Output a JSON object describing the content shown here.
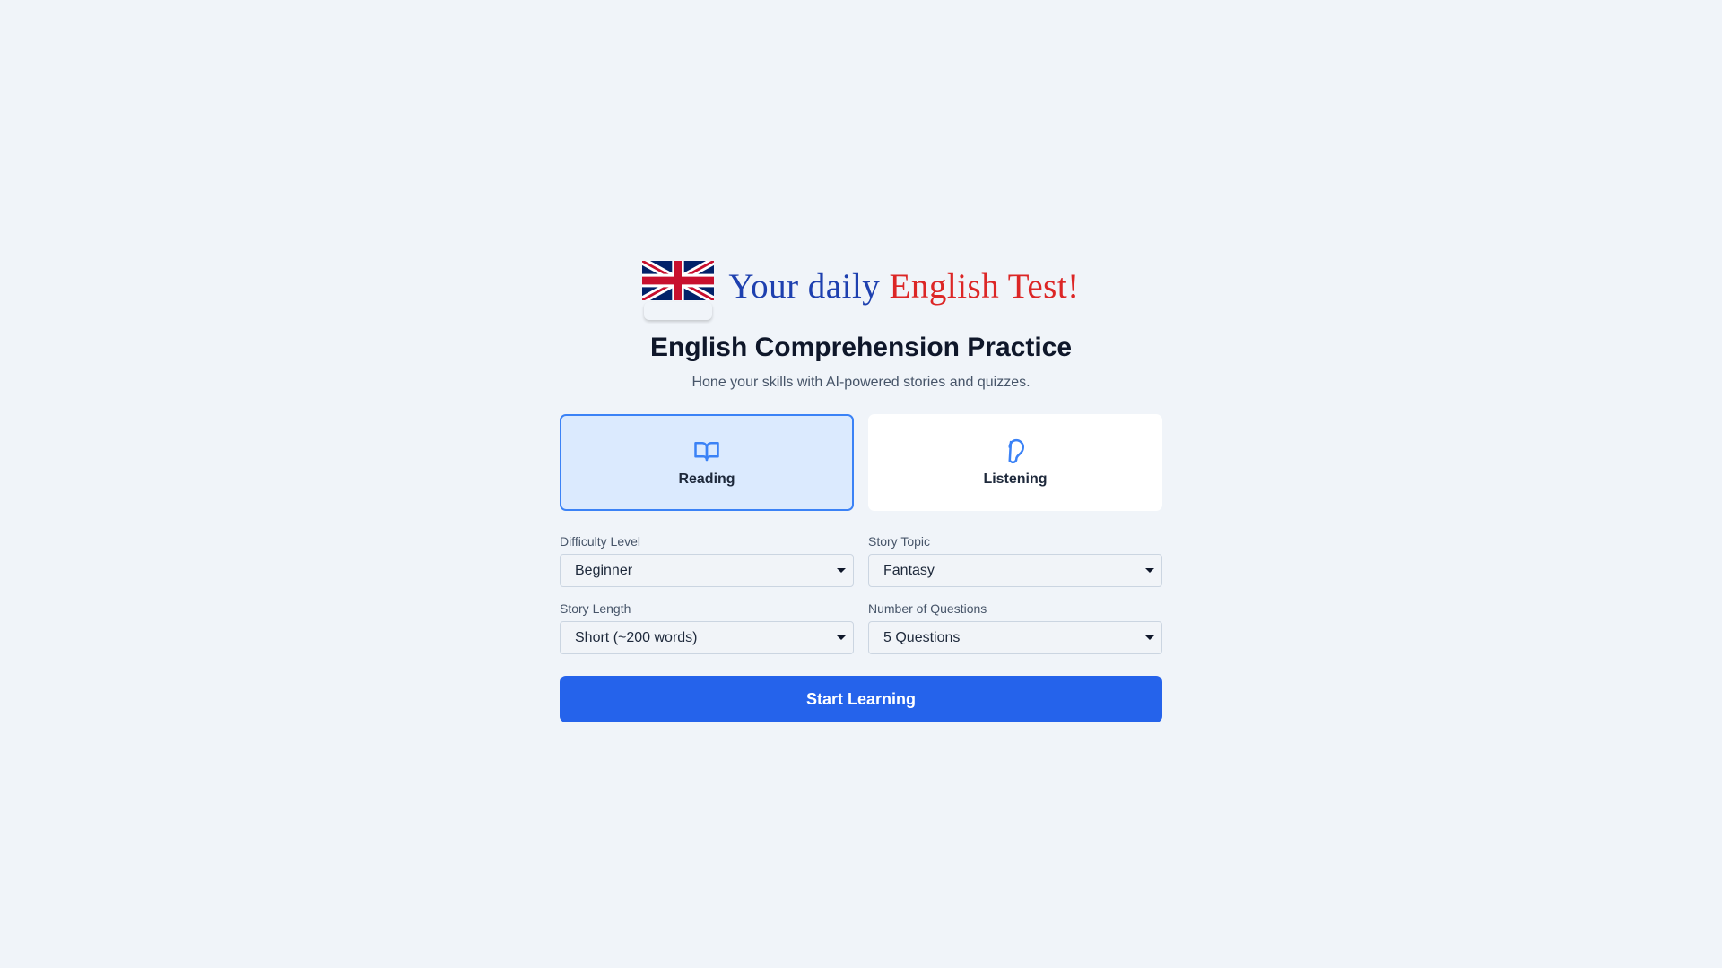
{
  "brand": {
    "title_part1": "Your daily",
    "title_part2": "English Test!",
    "flag_icon": "uk-flag-icon"
  },
  "header": {
    "title": "English Comprehension Practice",
    "subtitle": "Hone your skills with AI-powered stories and quizzes."
  },
  "modes": [
    {
      "label": "Reading",
      "icon": "open-book-icon",
      "selected": true
    },
    {
      "label": "Listening",
      "icon": "ear-icon",
      "selected": false
    }
  ],
  "settings": {
    "difficulty": {
      "label": "Difficulty Level",
      "value": "Beginner"
    },
    "topic": {
      "label": "Story Topic",
      "value": "Fantasy"
    },
    "length": {
      "label": "Story Length",
      "value": "Short (~200 words)"
    },
    "questions": {
      "label": "Number of Questions",
      "value": "5 Questions"
    }
  },
  "actions": {
    "start_label": "Start Learning"
  },
  "colors": {
    "primary": "#2563eb",
    "brand_blue": "#1e40af",
    "brand_red": "#dc2626",
    "selected_card_bg": "#dbeafe",
    "selected_card_border": "#3b82f6",
    "background": "#f0f4f9"
  }
}
